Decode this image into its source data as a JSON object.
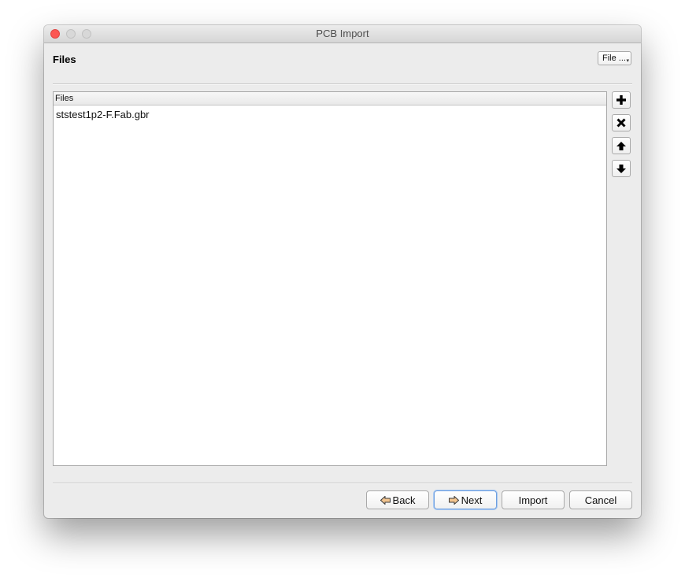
{
  "window": {
    "title": "PCB Import"
  },
  "header": {
    "section_title": "Files",
    "file_menu_label": "File ...",
    "file_menu_arrow": "▾"
  },
  "files_table": {
    "column_header": "Files",
    "rows": [
      "ststest1p2-F.Fab.gbr"
    ]
  },
  "side_buttons": {
    "add_icon": "plus-icon",
    "remove_icon": "x-icon",
    "move_up_icon": "arrow-up-icon",
    "move_down_icon": "arrow-down-icon"
  },
  "footer": {
    "back_label": "Back",
    "next_label": "Next",
    "import_label": "Import",
    "cancel_label": "Cancel"
  },
  "colors": {
    "window_bg": "#ececec",
    "close_button": "#fc5753",
    "focus_ring": "#6d9fe0",
    "arrow_icon_fill": "#f2c48f"
  }
}
